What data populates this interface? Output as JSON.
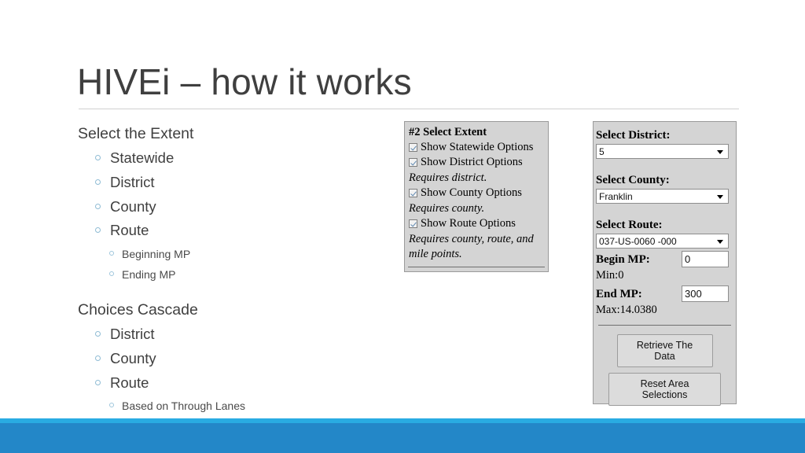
{
  "slide": {
    "title": "HIVEi – how it works"
  },
  "outline": [
    {
      "heading": "Select the Extent",
      "items": [
        {
          "label": "Statewide",
          "children": []
        },
        {
          "label": "District",
          "children": []
        },
        {
          "label": "County",
          "children": []
        },
        {
          "label": "Route",
          "children": [
            "Beginning MP",
            "Ending MP"
          ]
        }
      ]
    },
    {
      "heading": "Choices Cascade",
      "items": [
        {
          "label": "District",
          "children": []
        },
        {
          "label": "County",
          "children": []
        },
        {
          "label": "Route",
          "children": [
            "Based on Through Lanes"
          ]
        }
      ]
    }
  ],
  "extent_panel": {
    "title": "#2 Select Extent",
    "rows": [
      {
        "type": "checkbox",
        "label": "Show Statewide Options",
        "checked": true
      },
      {
        "type": "checkbox",
        "label": "Show District Options",
        "checked": true
      },
      {
        "type": "note",
        "label": "Requires district."
      },
      {
        "type": "checkbox",
        "label": "Show County Options",
        "checked": true
      },
      {
        "type": "note",
        "label": "Requires county."
      },
      {
        "type": "checkbox",
        "label": "Show Route Options",
        "checked": true
      },
      {
        "type": "note",
        "label": "Requires county, route, and"
      },
      {
        "type": "note",
        "label": "mile points."
      }
    ]
  },
  "area_panel": {
    "district": {
      "label": "Select District:",
      "value": "5"
    },
    "county": {
      "label": "Select County:",
      "value": "Franklin"
    },
    "route": {
      "label": "Select Route:",
      "value": "037-US-0060 -000"
    },
    "begin_mp": {
      "label": "Begin MP:",
      "value": "0",
      "hint": "Min:0"
    },
    "end_mp": {
      "label": "End MP:",
      "value": "300",
      "hint": "Max:14.0380"
    },
    "buttons": {
      "retrieve": "Retrieve The Data",
      "reset": "Reset Area Selections"
    }
  },
  "colors": {
    "bar_main": "#2387c8",
    "bar_accent": "#29abe2",
    "panel_bg": "#d4d4d4",
    "title_text": "#3f3f3f",
    "bullet_marker": "#8fbcd4"
  }
}
